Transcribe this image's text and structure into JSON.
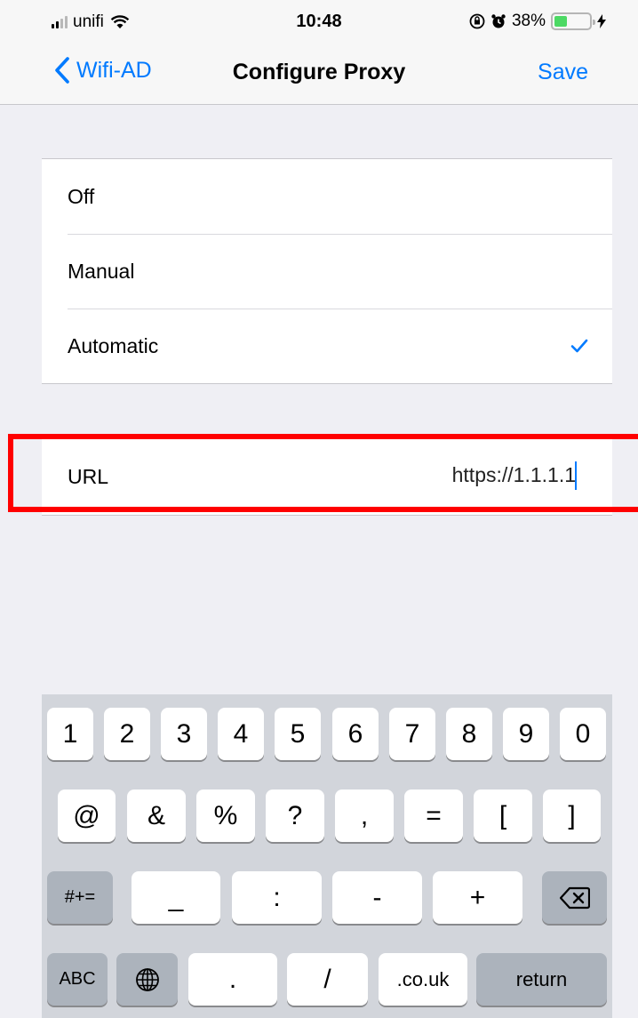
{
  "status_bar": {
    "carrier": "unifi",
    "time": "10:48",
    "battery_percent": "38%",
    "battery_level": 0.38,
    "icons": [
      "signal-icon",
      "wifi-icon",
      "orientation-lock-icon",
      "alarm-icon",
      "battery-icon",
      "charging-icon"
    ]
  },
  "nav": {
    "back_label": "Wifi-AD",
    "title": "Configure Proxy",
    "save_label": "Save"
  },
  "proxy_options": [
    {
      "label": "Off",
      "selected": false
    },
    {
      "label": "Manual",
      "selected": false
    },
    {
      "label": "Automatic",
      "selected": true
    }
  ],
  "url_field": {
    "label": "URL",
    "value": "https://1.1.1.1"
  },
  "keyboard": {
    "row1": [
      "1",
      "2",
      "3",
      "4",
      "5",
      "6",
      "7",
      "8",
      "9",
      "0"
    ],
    "row2": [
      "@",
      "&",
      "%",
      "?",
      ",",
      "=",
      "[",
      "]"
    ],
    "row3": {
      "symbols_key": "#+=",
      "keys": [
        "_",
        ":",
        "-",
        "+"
      ],
      "delete_icon": "delete-icon"
    },
    "row4": {
      "abc_key": "ABC",
      "globe_icon": "globe-icon",
      "keys": [
        ".",
        "/",
        ".co.uk"
      ],
      "return_key": "return"
    }
  },
  "colors": {
    "accent": "#007aff",
    "highlight": "#ff0000",
    "battery_fill": "#4cd964"
  }
}
